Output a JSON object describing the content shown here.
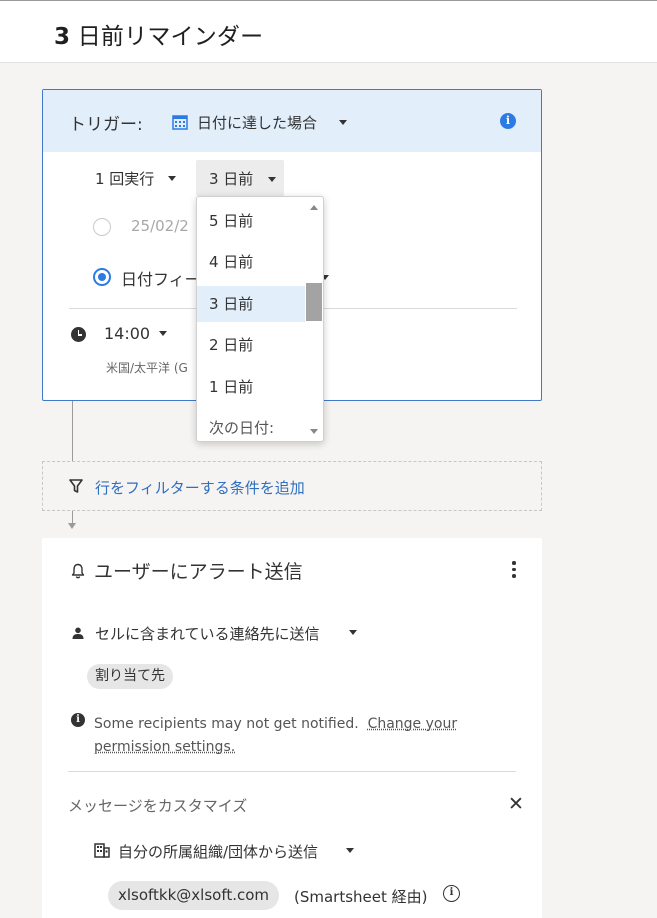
{
  "header": {
    "title_bold": "3",
    "title_rest": " 日前リマインダー"
  },
  "trigger": {
    "label": "トリガー:",
    "type_value": "日付に達した場合",
    "repeat_label": "1 回実行",
    "days_value": "3 日前",
    "date_partial": "25/02/2",
    "date_field_label": "日付フィー",
    "time_value": "14:00",
    "timezone": "米国/太平洋 (G"
  },
  "dropdown": {
    "options": [
      "5 日前",
      "4 日前",
      "3 日前",
      "2 日前",
      "1 日前",
      "次の日付:"
    ],
    "selected": "3 日前"
  },
  "filter": {
    "label": "行をフィルターする条件を追加"
  },
  "action": {
    "title": "ユーザーにアラート送信",
    "send_to": "セルに含まれている連絡先に送信",
    "chip": "割り当て先",
    "notice_text": "Some recipients may not get notified.",
    "notice_link_1": "Change your",
    "notice_link_2": "permission settings.",
    "customize_label": "メッセージをカスタマイズ",
    "close_symbol": "✕",
    "org_send": "自分の所属組織/団体から送信",
    "email": "xlsoftkk@xlsoft.com",
    "via": "(Smartsheet 経由)"
  },
  "icons": [
    "calendar-icon",
    "info-icon",
    "clock-icon",
    "filter-icon",
    "bell-icon",
    "kebab-menu-icon",
    "person-icon",
    "building-icon",
    "close-icon"
  ],
  "colors": {
    "accent": "#2c7be5",
    "link": "#2f6fbf",
    "trigger_bg": "#e2eefa",
    "page_bg": "#f5f4f2"
  }
}
